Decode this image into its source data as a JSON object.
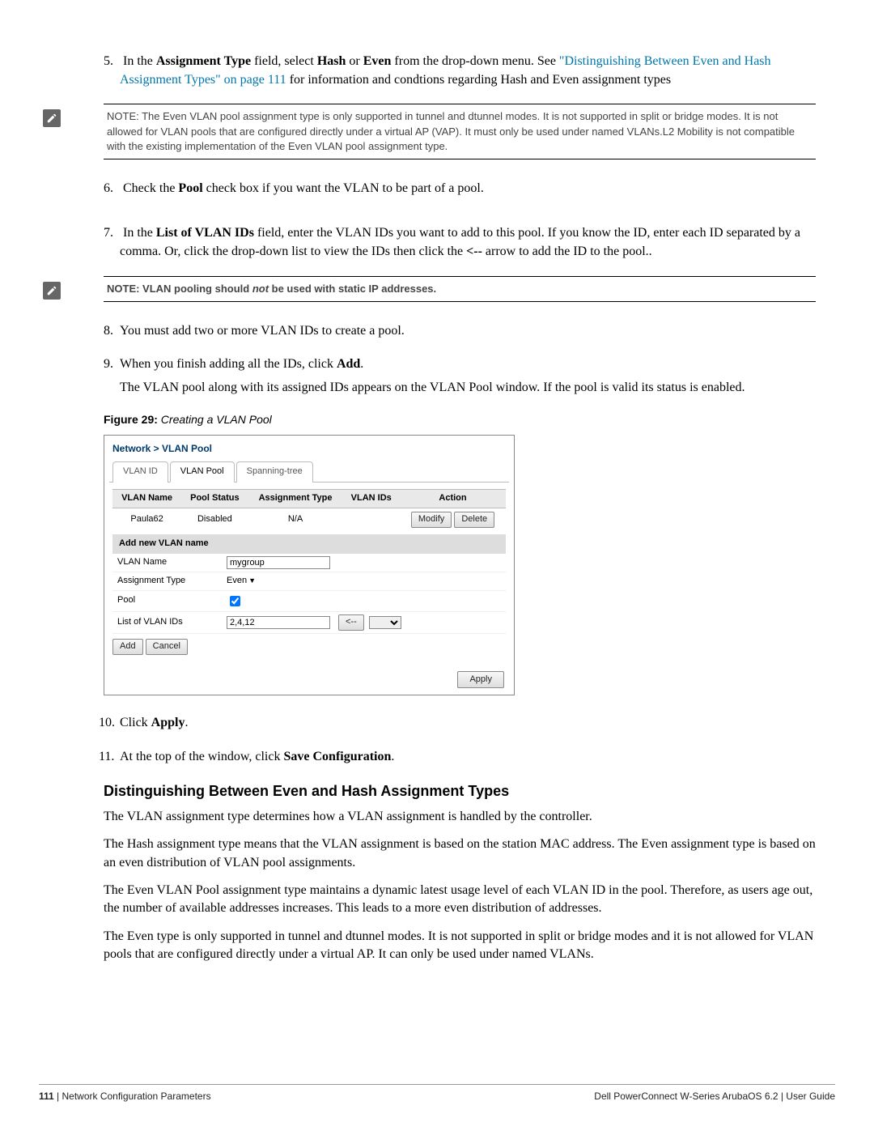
{
  "steps": {
    "s5_a": "In the ",
    "s5_b": "Assignment Type",
    "s5_c": " field, select ",
    "s5_d": "Hash",
    "s5_e": " or ",
    "s5_f": "Even",
    "s5_g": " from the drop-down menu. See ",
    "s5_link": "\"Distinguishing Between Even and Hash Assignment Types\" on page 111",
    "s5_h": " for information and condtions regarding Hash and Even assignment types",
    "s6_a": "Check the ",
    "s6_b": "Pool",
    "s6_c": " check box if you want the VLAN to be part of a pool.",
    "s7_a": "In the ",
    "s7_b": "List of VLAN IDs",
    "s7_c": " field, enter the VLAN IDs you want to add to this pool. If you know the ID, enter each ID separated by a comma. Or, click the drop-down list to view the IDs then click the ",
    "s7_d": "<--",
    "s7_e": " arrow to add the ID to the pool..",
    "s8": "You must add two or more VLAN IDs to create a pool.",
    "s9_a": "When you finish adding all the IDs, click ",
    "s9_b": "Add",
    "s9_c": ".",
    "s9_follow": "The VLAN pool along with its assigned IDs appears on the VLAN Pool window. If the pool is valid its status is enabled.",
    "s10_a": "Click ",
    "s10_b": "Apply",
    "s10_c": ".",
    "s11_a": "At the top of the window, click ",
    "s11_b": "Save Configuration",
    "s11_c": "."
  },
  "note1": "NOTE: The Even VLAN pool assignment type is only supported in tunnel and dtunnel modes. It is not supported in split or bridge modes. It is not allowed for VLAN pools that are configured directly under a virtual AP (VAP). It must only be used under named VLANs.L2 Mobility is not compatible with the existing implementation of the Even VLAN pool assignment type.",
  "note2_a": "NOTE: VLAN pooling should ",
  "note2_b": "not",
  "note2_c": " be used with static IP addresses.",
  "figure": {
    "label": "Figure 29:",
    "title": " Creating a VLAN Pool"
  },
  "shot": {
    "breadcrumb": "Network > VLAN Pool",
    "tabs": [
      "VLAN ID",
      "VLAN Pool",
      "Spanning-tree"
    ],
    "headers": [
      "VLAN Name",
      "Pool Status",
      "Assignment Type",
      "VLAN IDs",
      "Action"
    ],
    "row": {
      "name": "Paula62",
      "status": "Disabled",
      "atype": "N/A",
      "ids": "",
      "modify": "Modify",
      "delete": "Delete"
    },
    "section": "Add new VLAN name",
    "f_vlan_name_label": "VLAN Name",
    "f_vlan_name_value": "mygroup",
    "f_atype_label": "Assignment Type",
    "f_atype_value": "Even",
    "f_pool_label": "Pool",
    "f_list_label": "List of VLAN IDs",
    "f_list_value": "2,4,12",
    "arrow_btn": "<--",
    "add": "Add",
    "cancel": "Cancel",
    "apply": "Apply"
  },
  "section_title": "Distinguishing Between Even and Hash Assignment Types",
  "p1": "The VLAN assignment type determines how a VLAN assignment is handled by the controller.",
  "p2": "The Hash assignment type means that the VLAN assignment is based on the station MAC address. The Even assignment type is based on an even distribution of VLAN pool assignments.",
  "p3": "The Even VLAN Pool assignment type maintains a dynamic latest usage level of each VLAN ID in the pool. Therefore, as users age out, the number of available addresses increases. This leads to a more even distribution of addresses.",
  "p4": "The Even type is only supported in tunnel and dtunnel modes. It is not supported in split or bridge modes and it is not allowed for VLAN pools that are configured directly under a virtual AP. It can only be used under named VLANs.",
  "footer": {
    "left_a": "111",
    "left_b": " | Network Configuration Parameters",
    "right": "Dell PowerConnect W-Series ArubaOS 6.2  |  User Guide"
  }
}
